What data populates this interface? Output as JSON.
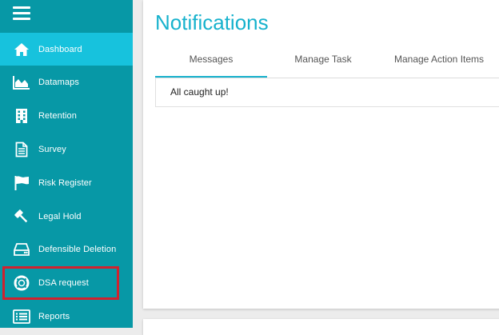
{
  "sidebar": {
    "menu_icon": "hamburger-menu-icon",
    "items": [
      {
        "label": "Dashboard",
        "icon": "home-icon",
        "active": true
      },
      {
        "label": "Datamaps",
        "icon": "area-chart-icon"
      },
      {
        "label": "Retention",
        "icon": "building-icon"
      },
      {
        "label": "Survey",
        "icon": "document-icon"
      },
      {
        "label": "Risk Register",
        "icon": "flag-icon"
      },
      {
        "label": "Legal Hold",
        "icon": "gavel-icon"
      },
      {
        "label": "Defensible Deletion",
        "icon": "hard-drive-icon"
      },
      {
        "label": "DSA request",
        "icon": "life-ring-icon",
        "highlighted": true
      },
      {
        "label": "Reports",
        "icon": "list-icon"
      }
    ]
  },
  "main": {
    "title": "Notifications",
    "tabs": [
      {
        "label": "Messages",
        "active": true
      },
      {
        "label": "Manage Task"
      },
      {
        "label": "Manage Action Items"
      }
    ],
    "message": "All caught up!"
  },
  "colors": {
    "sidebar_bg": "#0798a6",
    "active_item_bg": "#17c2dd",
    "accent": "#17b2cd",
    "highlight_border": "#d0222e"
  }
}
